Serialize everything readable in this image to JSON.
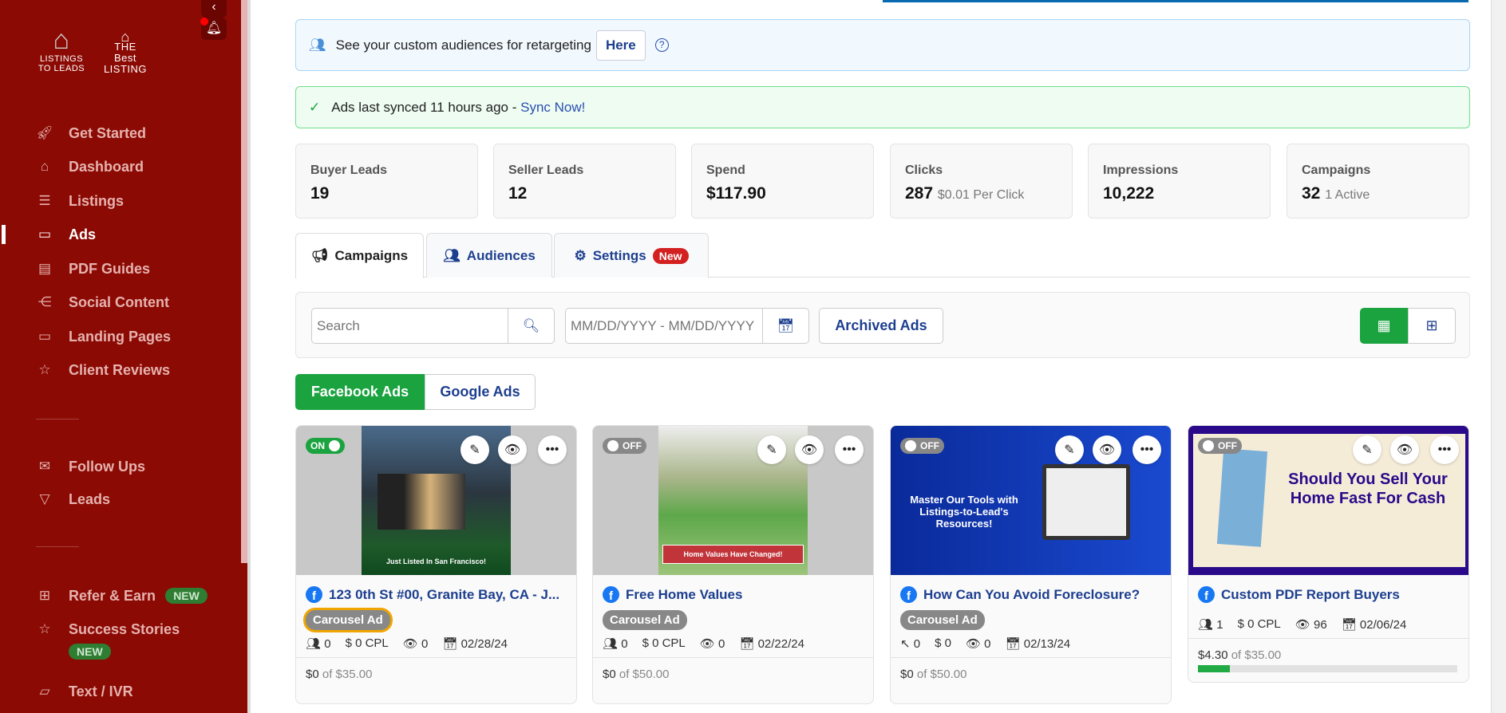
{
  "sidebar": {
    "logo1": "LISTINGS TO LEADS",
    "logo2": "THE Best LISTING",
    "items": [
      {
        "label": "Get Started",
        "icon": "rocket-icon"
      },
      {
        "label": "Dashboard",
        "icon": "home-icon"
      },
      {
        "label": "Listings",
        "icon": "list-icon"
      },
      {
        "label": "Ads",
        "icon": "ad-icon",
        "active": true
      },
      {
        "label": "PDF Guides",
        "icon": "pdf-icon"
      },
      {
        "label": "Social Content",
        "icon": "share-icon"
      },
      {
        "label": "Landing Pages",
        "icon": "window-icon"
      },
      {
        "label": "Client Reviews",
        "icon": "star-icon"
      }
    ],
    "items2": [
      {
        "label": "Follow Ups",
        "icon": "mail-icon"
      },
      {
        "label": "Leads",
        "icon": "filter-icon"
      }
    ],
    "items3": [
      {
        "label": "Refer & Earn",
        "badge": "NEW",
        "icon": "gift-icon"
      },
      {
        "label": "Success Stories",
        "badge": "NEW",
        "icon": "star-icon"
      },
      {
        "label": "Text / IVR",
        "icon": "chat-icon"
      }
    ]
  },
  "alerts": {
    "audience_text": "See your custom audiences for retargeting",
    "audience_button": "Here",
    "sync_text": "Ads last synced 11 hours ago - ",
    "sync_link": "Sync Now!"
  },
  "stats": [
    {
      "label": "Buyer Leads",
      "value": "19",
      "sub": ""
    },
    {
      "label": "Seller Leads",
      "value": "12",
      "sub": ""
    },
    {
      "label": "Spend",
      "value": "$117.90",
      "sub": ""
    },
    {
      "label": "Clicks",
      "value": "287",
      "sub": "$0.01 Per Click"
    },
    {
      "label": "Impressions",
      "value": "10,222",
      "sub": ""
    },
    {
      "label": "Campaigns",
      "value": "32",
      "sub": "1 Active"
    }
  ],
  "tabs": [
    {
      "label": "Campaigns"
    },
    {
      "label": "Audiences"
    },
    {
      "label": "Settings",
      "badge": "New"
    }
  ],
  "filters": {
    "search_placeholder": "Search",
    "date_placeholder": "MM/DD/YYYY - MM/DD/YYYY",
    "archived": "Archived Ads"
  },
  "platforms": [
    "Facebook Ads",
    "Google Ads"
  ],
  "cards": [
    {
      "status": "ON",
      "title": "123 0th St #00, Granite Bay, CA - J...",
      "type": "Carousel Ad",
      "m1": "0",
      "m2": "0 CPL",
      "m3": "0",
      "date": "02/28/24",
      "spent": "$0",
      "budget": "of $35.00",
      "image_caption": "Just Listed In San Francisco!"
    },
    {
      "status": "OFF",
      "title": "Free Home Values",
      "type": "Carousel Ad",
      "m1": "0",
      "m2": "0 CPL",
      "m3": "0",
      "date": "02/22/24",
      "spent": "$0",
      "budget": "of $50.00",
      "image_caption": "Home Values Have Changed!"
    },
    {
      "status": "OFF",
      "title": "How Can You Avoid Foreclosure?",
      "type": "Carousel Ad",
      "m1": "0",
      "m2": "0",
      "m3": "0",
      "date": "02/13/24",
      "spent": "$0",
      "budget": "of $50.00",
      "image_caption": "Master Our Tools with Listings-to-Lead's Resources!"
    },
    {
      "status": "OFF",
      "title": "Custom PDF Report Buyers",
      "type": "",
      "m1": "1",
      "m2": "0 CPL",
      "m3": "96",
      "date": "02/06/24",
      "spent": "$4.30",
      "budget": "of $35.00",
      "progress": 0.123,
      "image_caption": "Should You Sell Your Home Fast For Cash"
    }
  ],
  "colors": {
    "sidebar": "#8b0a04",
    "primary": "#1d3f8f",
    "green": "#1aa33f"
  }
}
